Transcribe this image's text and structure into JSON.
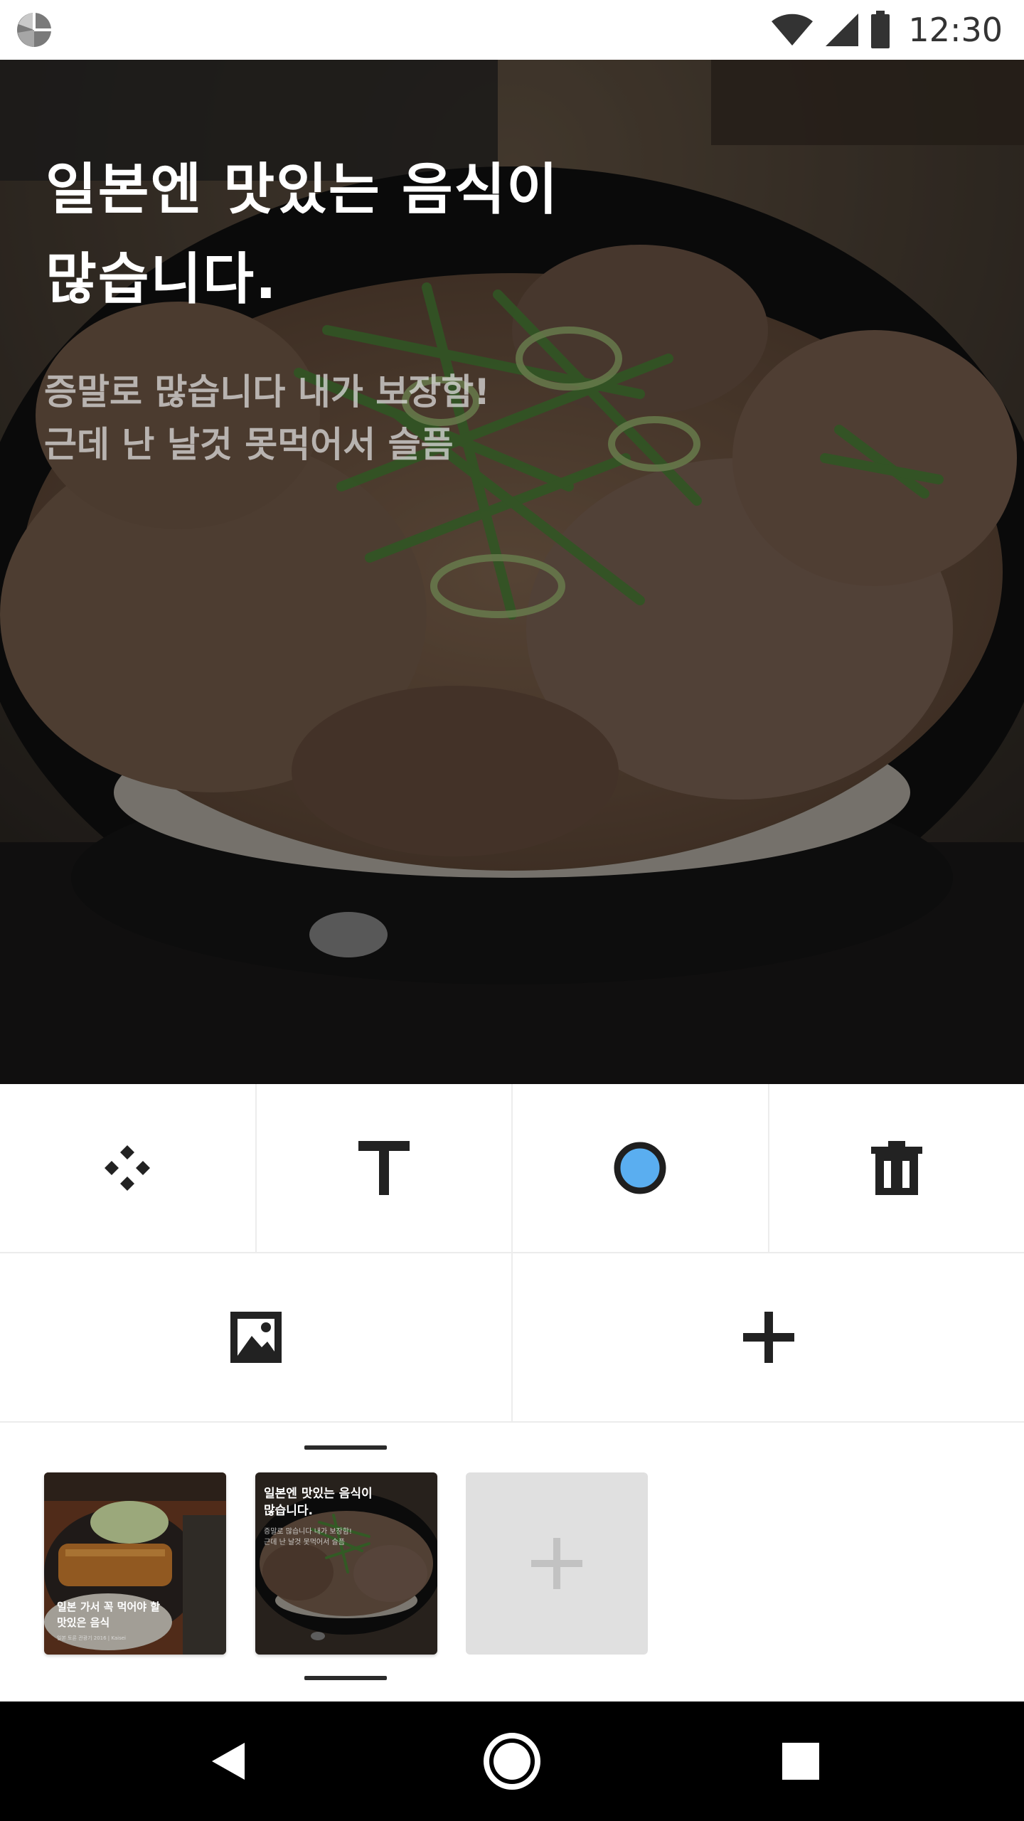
{
  "status_bar": {
    "time": "12:30",
    "icons": [
      "app-logo",
      "wifi-icon",
      "signal-icon",
      "battery-icon"
    ]
  },
  "hero": {
    "title_line1": "일본엔 맛있는 음식이",
    "title_line2": "많습니다.",
    "subtitle_line1": "증말로 많습니다 내가 보장함!",
    "subtitle_line2": "근데 난 날것 못먹어서 슬픔"
  },
  "tools": {
    "row1": [
      "move-icon",
      "text-icon",
      "color-icon",
      "delete-icon"
    ],
    "row2": [
      "image-icon",
      "add-icon"
    ],
    "accent_color": "#5aaef0"
  },
  "pages": [
    {
      "title_line1": "일본 가서 꼭 먹어야 할",
      "title_line2": "맛있은 음식",
      "subtitle": "일본 토론 관광기 2016 | Kaisei"
    },
    {
      "title_line1": "일본엔 맛있는 음식이",
      "title_line2": "많습니다.",
      "subtitle_line1": "증말로 많습니다 내가 보장함!",
      "subtitle_line2": "근데 난 날것 못먹어서 슬픔"
    }
  ],
  "nav": [
    "back-icon",
    "home-icon",
    "recents-icon"
  ]
}
